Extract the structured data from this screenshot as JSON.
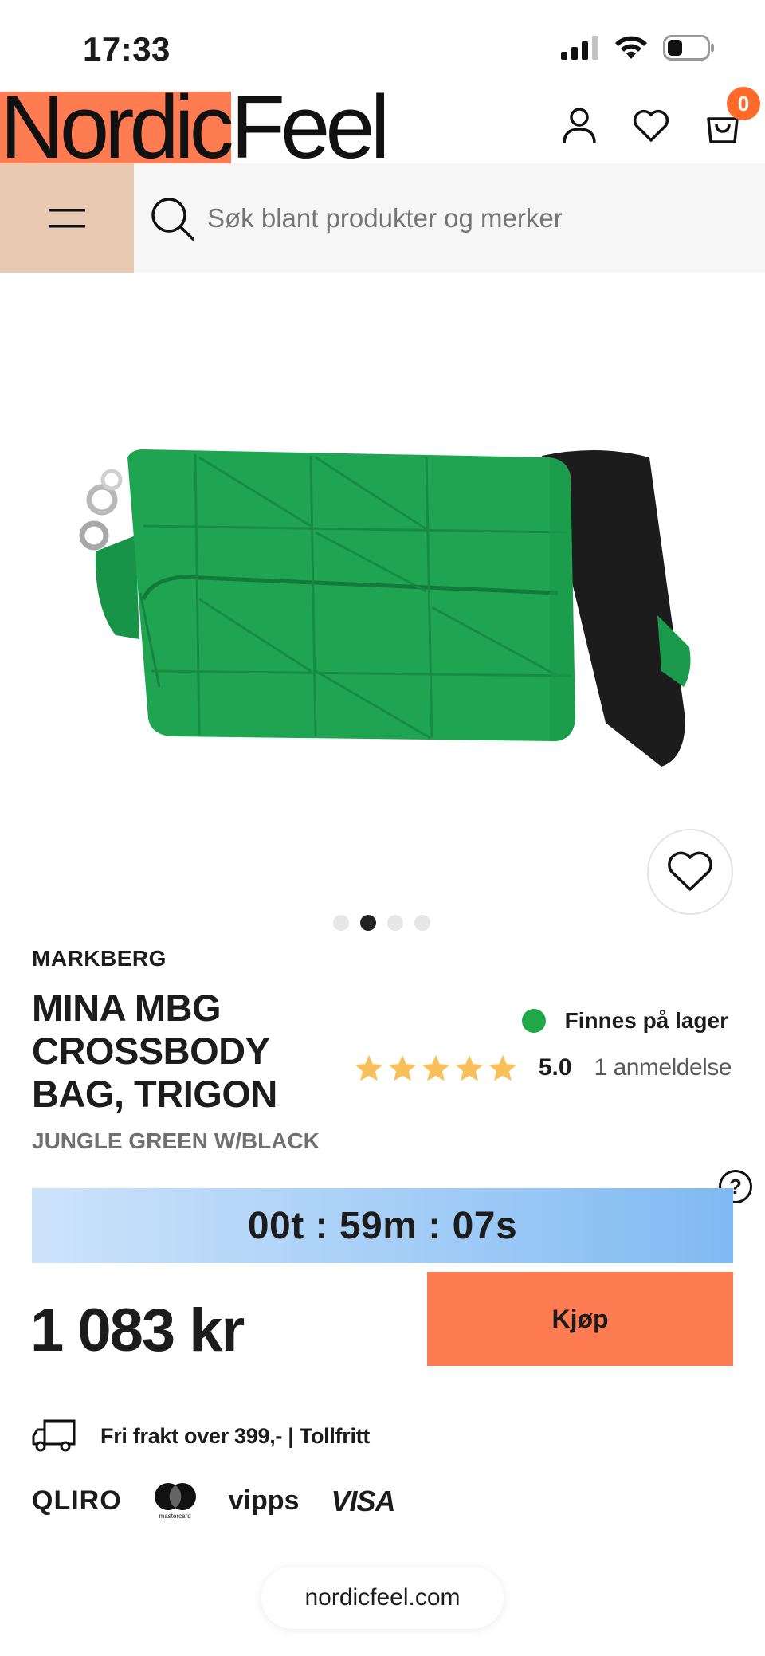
{
  "status_bar": {
    "time": "17:33"
  },
  "header": {
    "logo_part1": "Nordic",
    "logo_part2": "Feel",
    "cart_count": "0",
    "icons": [
      "account-icon",
      "heart-icon",
      "cart-icon"
    ]
  },
  "search": {
    "placeholder": "Søk blant produkter og merker"
  },
  "gallery": {
    "dot_count": 4,
    "active_index": 1
  },
  "product": {
    "brand": "MARKBERG",
    "title": "MINA MBG CROSSBODY BAG, TRIGON",
    "variant": "JUNGLE GREEN W/BLACK",
    "stock_text": "Finnes på lager",
    "rating_value": "5.0",
    "rating_stars": 5,
    "rating_count": "1 anmeldelse",
    "timer": "00t : 59m : 07s",
    "help": "?",
    "price": "1 083 kr",
    "buy_label": "Kjøp",
    "shipping_text": "Fri frakt over 399,- | Tollfritt"
  },
  "payments": {
    "qliro": "QLIRO",
    "mastercard_sub": "mastercard",
    "vipps": "vipps",
    "visa": "VISA"
  },
  "browser": {
    "url": "nordicfeel.com"
  },
  "colors": {
    "logo_accent": "#ff7c52",
    "menu_bg": "#e8c9b2",
    "buy": "#ff7c52",
    "stock": "#20a848",
    "stars": "#f7c05a",
    "badge": "#ff6a2b"
  }
}
